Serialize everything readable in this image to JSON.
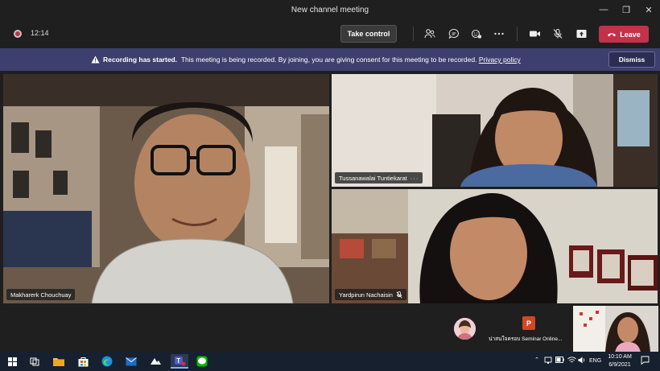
{
  "window": {
    "title": "New channel meeting",
    "controls": [
      "minimize",
      "restore",
      "close"
    ]
  },
  "toolbar": {
    "timer": "12:14",
    "take_control_label": "Take control",
    "leave_label": "Leave",
    "icons": [
      "people-icon",
      "chat-icon",
      "reactions-icon",
      "more-icon",
      "camera-icon",
      "mic-off-icon",
      "share-icon"
    ]
  },
  "banner": {
    "title": "Recording has started.",
    "message": "This meeting is being recorded. By joining, you are giving consent for this meeting to be recorded.",
    "link": "Privacy policy",
    "dismiss_label": "Dismiss"
  },
  "participants": [
    {
      "name": "Makharerk Chouchuay",
      "muted": false
    },
    {
      "name": "Tussanawalai Tuntiekarat",
      "muted": false
    },
    {
      "name": "Yardpirun Nachaisin",
      "muted": true
    }
  ],
  "shared_content": {
    "label": "น่าสนใจครอบ Seminar Online..."
  },
  "taskbar": {
    "language": "ENG",
    "time": "10:10 AM",
    "date": "6/9/2021"
  },
  "colors": {
    "leave": "#c4314b",
    "banner": "#3d3f6e",
    "toolbar": "#1f1f1f",
    "taskbar": "#16202e"
  }
}
